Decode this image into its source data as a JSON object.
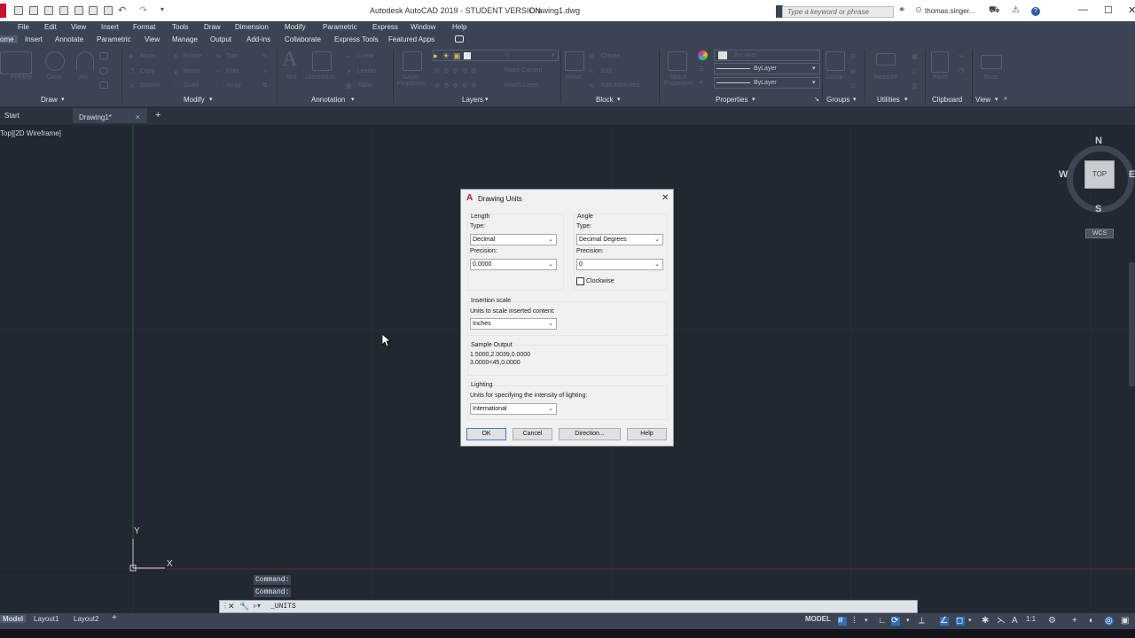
{
  "titlebar": {
    "title": "Autodesk AutoCAD 2019 - STUDENT VERSION",
    "filename": "Drawing1.dwg",
    "search_placeholder": "Type a keyword or phrase",
    "user": "thomas.singer..."
  },
  "menubar": {
    "items": [
      "File",
      "Edit",
      "View",
      "Insert",
      "Format",
      "Tools",
      "Draw",
      "Dimension",
      "Modify",
      "Parametric",
      "Express",
      "Window",
      "Help"
    ]
  },
  "ribbon_tabs": {
    "items": [
      "ome",
      "Insert",
      "Annotate",
      "Parametric",
      "View",
      "Manage",
      "Output",
      "Add-ins",
      "Collaborate",
      "Express Tools",
      "Featured Apps"
    ]
  },
  "ribbon": {
    "draw": {
      "title": "Draw",
      "tools": [
        "Polyline",
        "Circle",
        "Arc"
      ]
    },
    "modify": {
      "title": "Modify",
      "tools": [
        "Move",
        "Rotate",
        "Trim",
        "Copy",
        "Mirror",
        "Fillet",
        "Stretch",
        "Scale",
        "Array"
      ]
    },
    "annotation": {
      "title": "Annotation",
      "tools": [
        "Text",
        "Dimension",
        "Linear",
        "Leader",
        "Table"
      ]
    },
    "layers": {
      "title": "Layers",
      "tools": [
        "Layer Properties",
        "Make Current",
        "Match Layer"
      ],
      "layer_value": "0"
    },
    "block": {
      "title": "Block",
      "tools": [
        "Insert",
        "Create",
        "Edit",
        "Edit Attributes"
      ]
    },
    "properties": {
      "title": "Properties",
      "tools": [
        "Match Properties"
      ],
      "bylayer": [
        "ByLayer",
        "ByLayer",
        "ByLayer"
      ]
    },
    "groups": {
      "title": "Groups",
      "tools": [
        "Group"
      ]
    },
    "utilities": {
      "title": "Utilities",
      "tools": [
        "Measure"
      ]
    },
    "clipboard": {
      "title": "Clipboard",
      "tools": [
        "Paste"
      ]
    },
    "view": {
      "title": "View",
      "tools": [
        "Base"
      ]
    }
  },
  "file_tabs": {
    "start": "Start",
    "drawing": "Drawing1*"
  },
  "canvas": {
    "view_label": "Top][2D Wireframe]",
    "ucs_x": "X",
    "ucs_y": "Y",
    "compass": {
      "n": "N",
      "s": "S",
      "w": "W",
      "e": "E",
      "cube": "TOP",
      "wcs": "WCS"
    }
  },
  "dialog": {
    "title": "Drawing Units",
    "length": {
      "group": "Length",
      "type_label": "Type:",
      "type_value": "Decimal",
      "precision_label": "Precision:",
      "precision_value": "0.0000"
    },
    "angle": {
      "group": "Angle",
      "type_label": "Type:",
      "type_value": "Decimal Degrees",
      "precision_label": "Precision:",
      "precision_value": "0",
      "clockwise": "Clockwise",
      "clockwise_checked": false
    },
    "insertion": {
      "group": "Insertion scale",
      "label": "Units to scale inserted content:",
      "value": "Inches"
    },
    "sample": {
      "group": "Sample Output",
      "line1": "1.5000,2.0039,0.0000",
      "line2": "3.0000<45,0.0000"
    },
    "lighting": {
      "group": "Lighting",
      "label": "Units for specifying the intensity of lighting:",
      "value": "International"
    },
    "buttons": {
      "ok": "OK",
      "cancel": "Cancel",
      "direction": "Direction...",
      "help": "Help"
    }
  },
  "command": {
    "history": [
      "Command:",
      "Command:"
    ],
    "input": "_UNITS"
  },
  "statusbar": {
    "layout_tabs": [
      "Model",
      "Layout1",
      "Layout2"
    ],
    "model": "MODEL",
    "scale": "1:1"
  }
}
